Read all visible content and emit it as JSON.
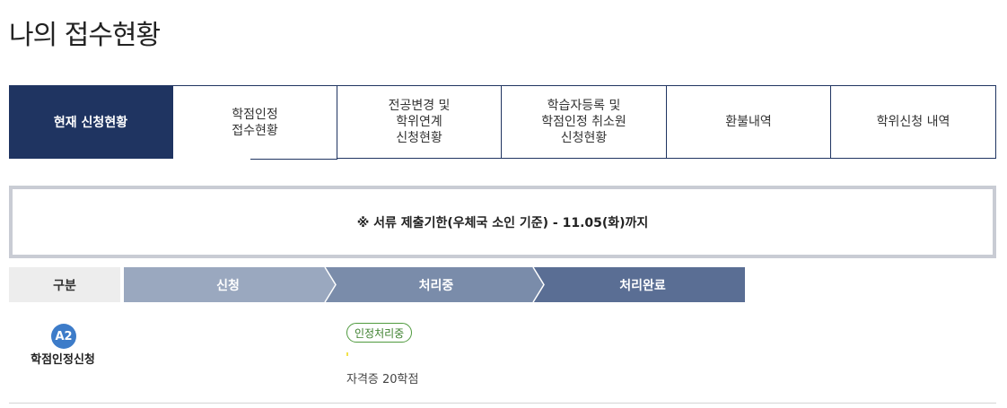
{
  "page_title": "나의 접수현황",
  "tabs": [
    {
      "label": "현재 신청현황",
      "active": true
    },
    {
      "label": "학점인정\n접수현황",
      "active": false
    },
    {
      "label": "전공변경 및\n학위연계\n신청현황",
      "active": false
    },
    {
      "label": "학습자등록 및\n학점인정 취소원\n신청현황",
      "active": false
    },
    {
      "label": "환불내역",
      "active": false
    },
    {
      "label": "학위신청 내역",
      "active": false
    }
  ],
  "notice": "※ 서류 제출기한(우체국 소인 기준) - 11.05(화)까지",
  "progress": {
    "label": "구분",
    "steps": [
      {
        "label": "신청",
        "color": "#9aa8bf"
      },
      {
        "label": "처리중",
        "color": "#7a8caa"
      },
      {
        "label": "처리완료",
        "color": "#5a6e94"
      }
    ]
  },
  "application": {
    "badge": "A2",
    "title": "학점인정신청",
    "status": "인정처리중",
    "detail": "자격증 20학점"
  }
}
